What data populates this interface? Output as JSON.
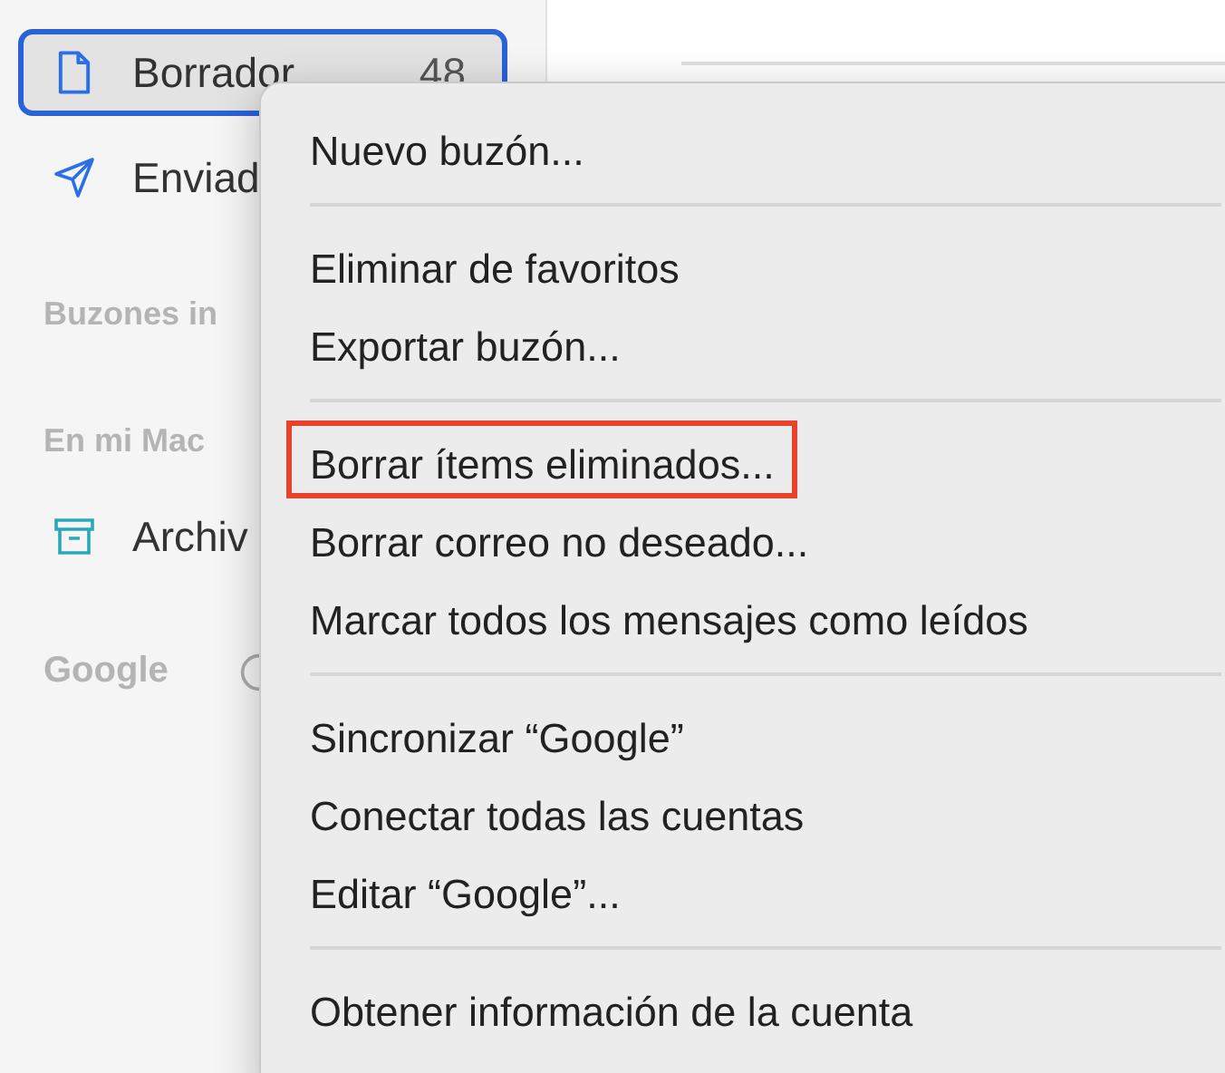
{
  "sidebar": {
    "items": [
      {
        "kind": "document",
        "label": "Borrador",
        "count": "48",
        "selected": true
      },
      {
        "kind": "send",
        "label": "Enviad",
        "selected": false
      },
      {
        "kind": "section",
        "label": "Buzones in"
      },
      {
        "kind": "section",
        "label": "En mi Mac"
      },
      {
        "kind": "archive",
        "label": "Archiv",
        "selected": false
      },
      {
        "kind": "account",
        "label": "Google"
      }
    ]
  },
  "context_menu": {
    "groups": [
      [
        {
          "label": "Nuevo buzón...",
          "highlighted": false
        }
      ],
      [
        {
          "label": "Eliminar de favoritos",
          "highlighted": false
        },
        {
          "label": "Exportar buzón...",
          "highlighted": false
        }
      ],
      [
        {
          "label": "Borrar ítems eliminados...",
          "highlighted": true
        },
        {
          "label": "Borrar correo no deseado...",
          "highlighted": false
        },
        {
          "label": "Marcar todos los mensajes como leídos",
          "highlighted": false
        }
      ],
      [
        {
          "label": "Sincronizar “Google”",
          "highlighted": false
        },
        {
          "label": "Conectar todas las cuentas",
          "highlighted": false
        },
        {
          "label": "Editar “Google”...",
          "highlighted": false
        }
      ],
      [
        {
          "label": "Obtener información de la cuenta",
          "highlighted": false
        }
      ]
    ]
  }
}
